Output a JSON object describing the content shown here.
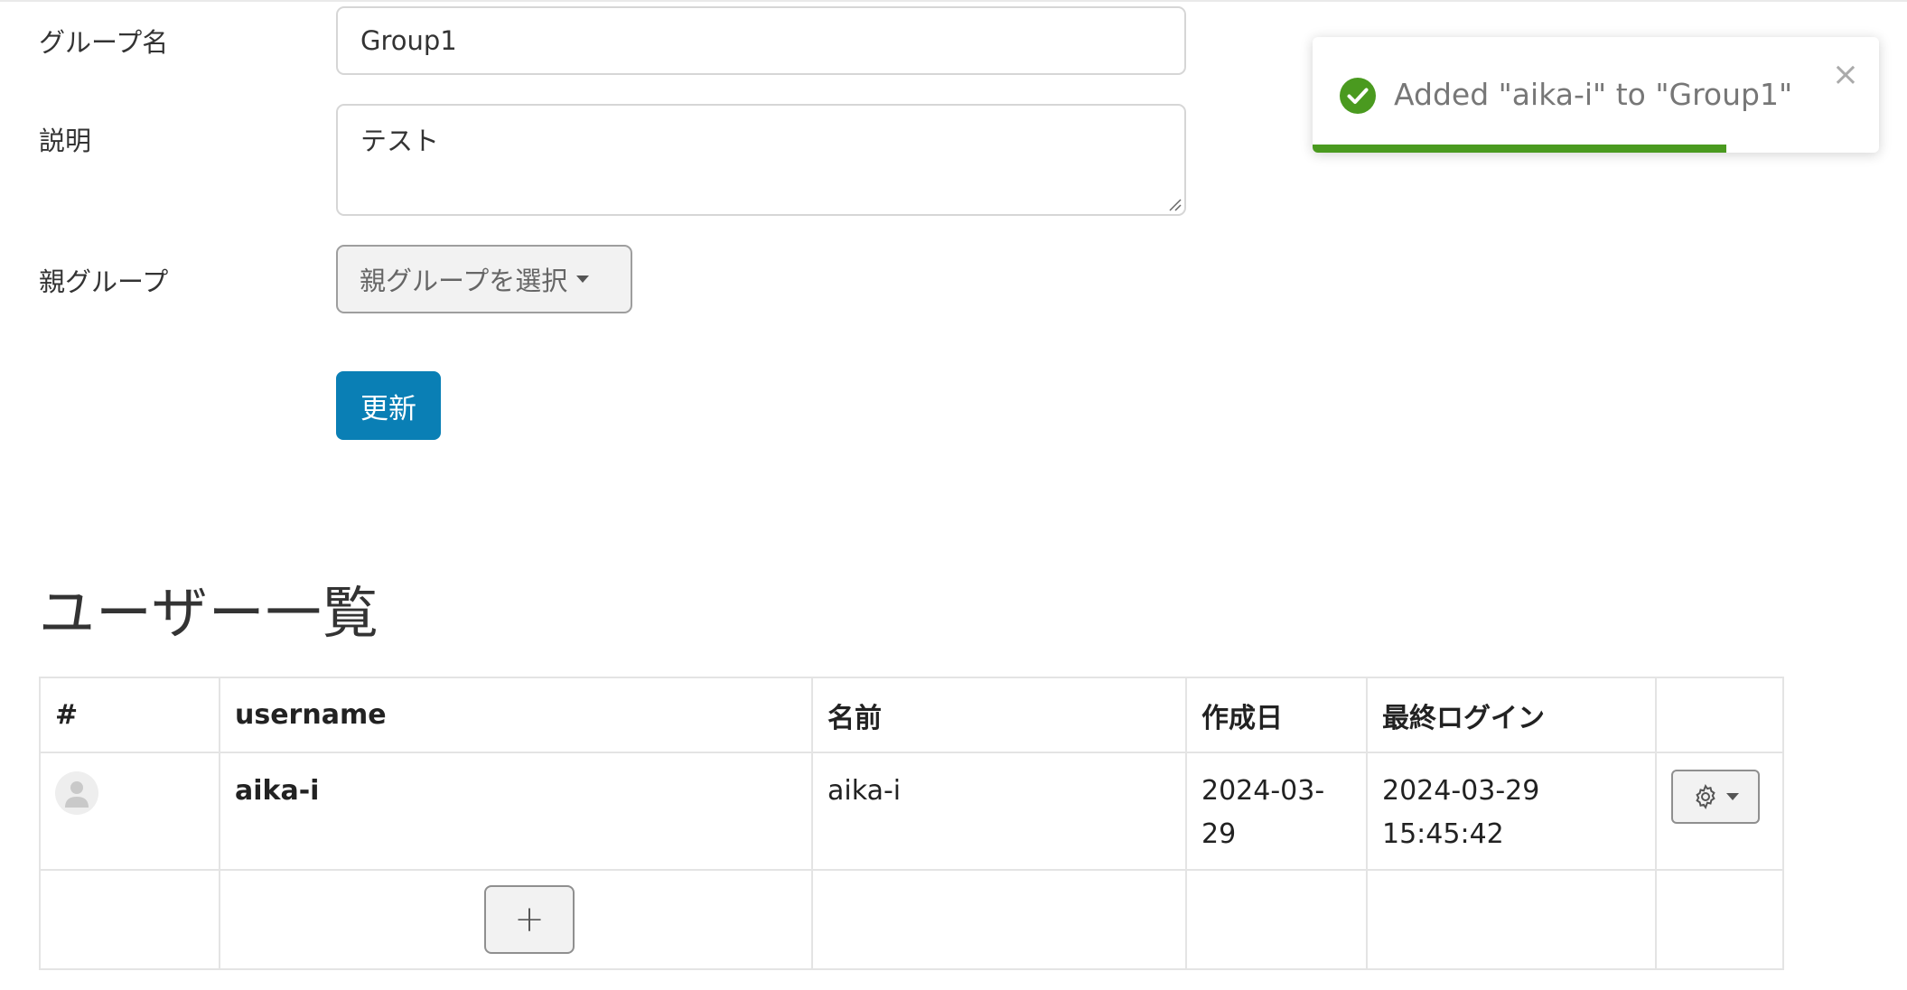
{
  "form": {
    "group_name_label": "グループ名",
    "group_name_value": "Group1",
    "description_label": "説明",
    "description_value": "テスト",
    "parent_label": "親グループ",
    "parent_select_label": "親グループを選択",
    "update_label": "更新"
  },
  "users_section": {
    "title": "ユーザー一覧",
    "columns": [
      "#",
      "username",
      "名前",
      "作成日",
      "最終ログイン",
      ""
    ],
    "rows": [
      {
        "username": "aika-i",
        "name": "aika-i",
        "created_line1": "2024-03-",
        "created_line2": "29",
        "last_login_line1": "2024-03-29",
        "last_login_line2": "15:45:42"
      }
    ],
    "add_label": "+"
  },
  "toast": {
    "message": "Added \"aika-i\" to \"Group1\"",
    "close_label": "×",
    "progress": 0.73
  },
  "colors": {
    "primary": "#0a7fb5",
    "success": "#4a9a1f"
  }
}
